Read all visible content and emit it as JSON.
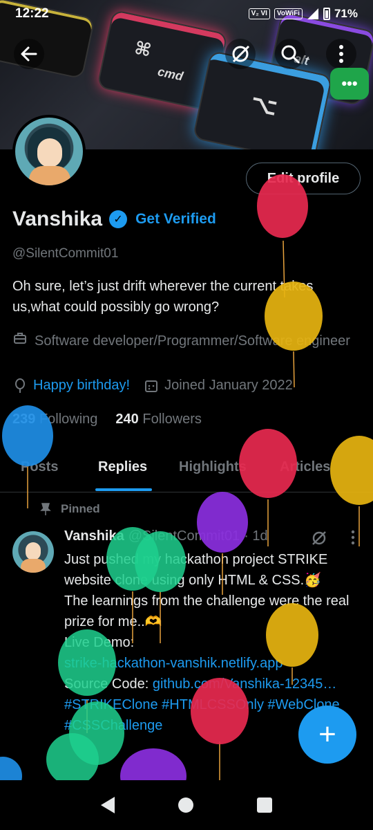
{
  "status": {
    "time": "12:22",
    "volte": "V₂ VI",
    "vowifi": "VoWiFi",
    "battery": "71%"
  },
  "banner": {
    "key1": "⌘",
    "key2": "cmd",
    "key3": "alt",
    "key4": "⌥"
  },
  "profile": {
    "edit_label": "Edit profile",
    "name": "Vanshika",
    "get_verified": "Get Verified",
    "handle": "@SilentCommit01",
    "bio": "Oh sure, let’s just drift wherever the current takes us,what could possibly go wrong?",
    "profession": "Software developer/Programmer/Software engineer",
    "birthday": "Happy birthday!",
    "joined": "Joined January 2022",
    "following_count": "239",
    "following_label": "Following",
    "followers_count": "240",
    "followers_label": "Followers"
  },
  "tabs": [
    "Posts",
    "Replies",
    "Highlights",
    "Articles"
  ],
  "post": {
    "pinned": "Pinned",
    "name": "Vanshika",
    "handle": "@SilentCommit01",
    "time": "· 1d",
    "line1": "Just pushed my hackathon project STRIKE website clone using only HTML & CSS.🥳",
    "line2": "The learnings from the challenge were the real prize for me..🫶",
    "demo_label": "Live Demo:",
    "demo_link": "strike-hackathon-vanshik.netlify.app",
    "source_label": "Source Code:",
    "source_link": "github.com/Vanshika-12345…",
    "hashtags": "#STRIKEClone #HTMLCSSOnly #WebClone #CSSChallenge"
  },
  "fab_label": "+",
  "green_chip": "•••",
  "colors": {
    "accent": "#1d9bf0",
    "muted": "#71767b",
    "text": "#e7e9ea",
    "fab": "#1d9bf0",
    "chip": "#1fa54a"
  },
  "icons": [
    "back-arrow-icon",
    "grok-icon",
    "search-icon",
    "more-vertical-icon",
    "verified-badge-icon",
    "briefcase-icon",
    "balloon-icon",
    "calendar-icon",
    "pin-icon",
    "plus-icon"
  ]
}
